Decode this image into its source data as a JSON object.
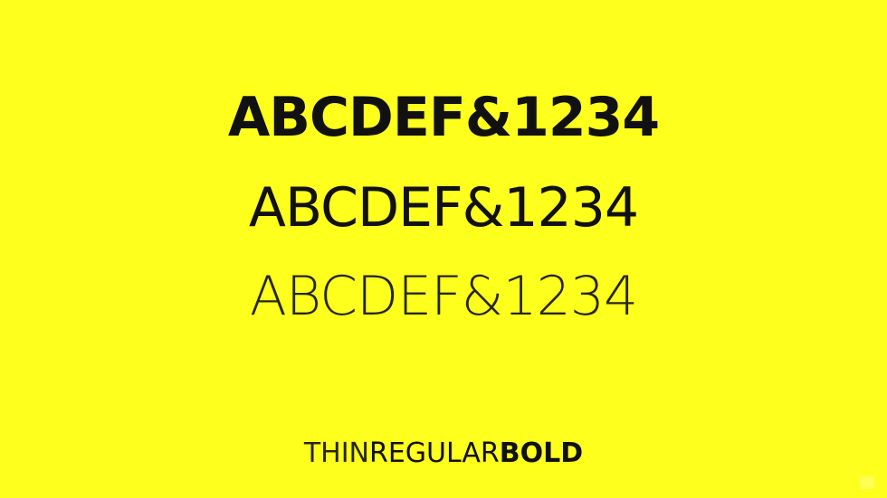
{
  "specimen": {
    "bold_line": "ABCDEF&1234",
    "regular_line": "ABCDEF&1234",
    "thin_line": "ABCDEF&1234"
  },
  "legend": {
    "thin": "THIN",
    "regular": "REGULAR",
    "bold": "BOLD"
  },
  "colors": {
    "background": "#ffff1e",
    "text": "#111111"
  }
}
